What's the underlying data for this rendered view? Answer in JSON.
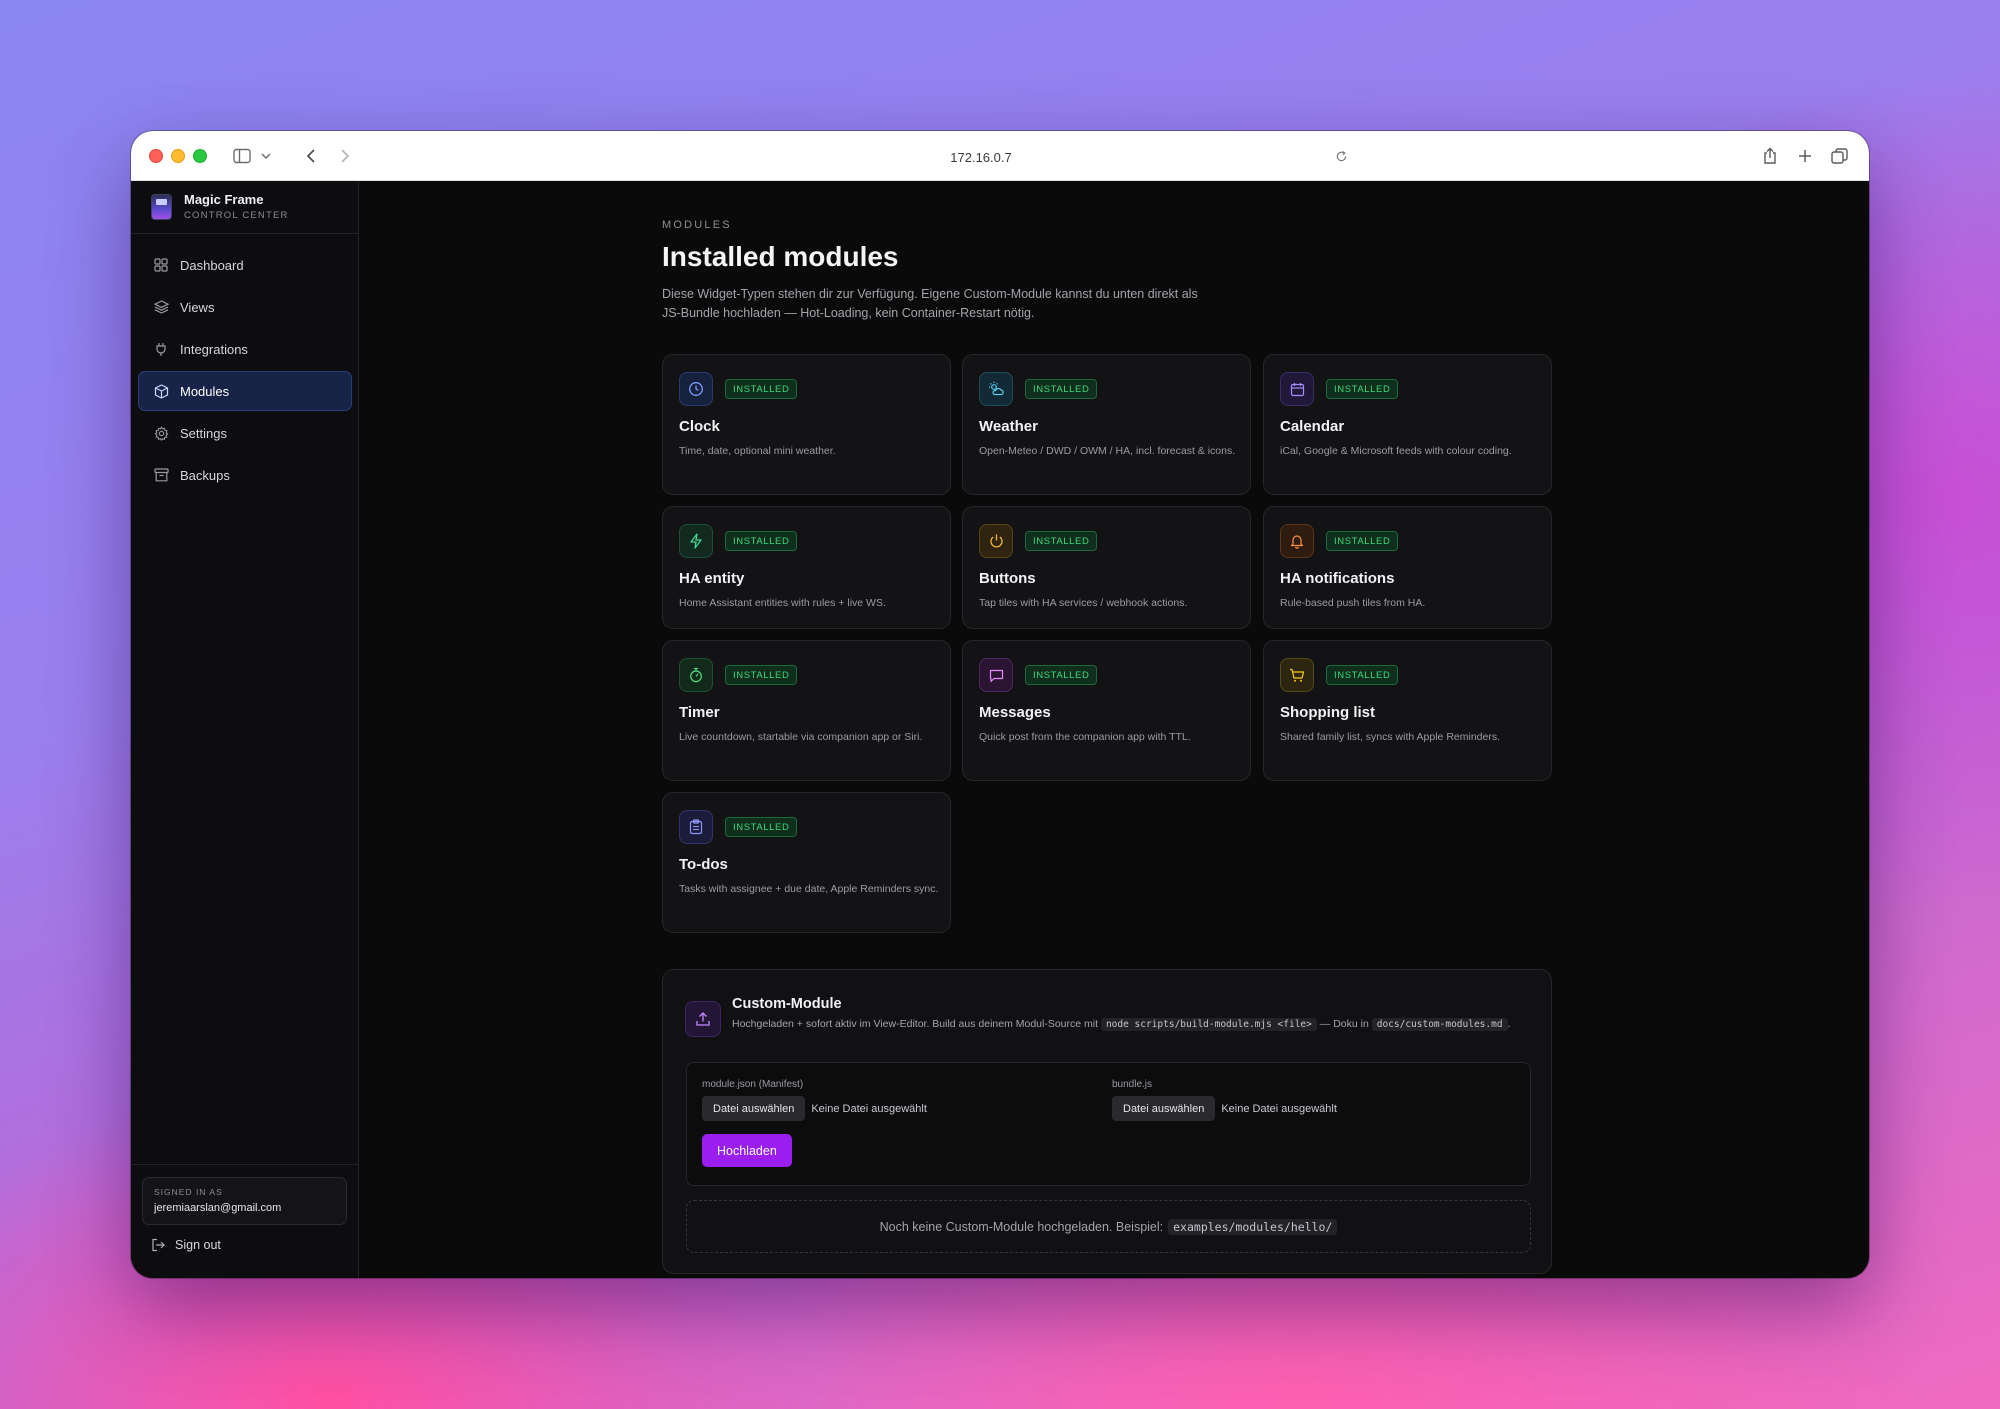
{
  "browser": {
    "url": "172.16.0.7"
  },
  "sidebar": {
    "brand_name": "Magic Frame",
    "brand_sub": "CONTROL CENTER",
    "items": [
      {
        "label": "Dashboard",
        "icon": "grid-icon",
        "active": false
      },
      {
        "label": "Views",
        "icon": "layers-icon",
        "active": false
      },
      {
        "label": "Integrations",
        "icon": "plug-icon",
        "active": false
      },
      {
        "label": "Modules",
        "icon": "box-icon",
        "active": true
      },
      {
        "label": "Settings",
        "icon": "gear-icon",
        "active": false
      },
      {
        "label": "Backups",
        "icon": "archive-icon",
        "active": false
      }
    ],
    "signed_in_label": "SIGNED IN AS",
    "signed_in_email": "jeremiaarslan@gmail.com",
    "sign_out_label": "Sign out"
  },
  "main": {
    "eyebrow": "MODULES",
    "title": "Installed modules",
    "description": "Diese Widget-Typen stehen dir zur Verfügung. Eigene Custom-Module kannst du unten direkt als JS-Bundle hochladen — Hot-Loading, kein Container-Restart nötig.",
    "modules": [
      {
        "title": "Clock",
        "desc": "Time, date, optional mini weather.",
        "badge": "INSTALLED",
        "icon": "clock-icon",
        "color": "#6b8cff"
      },
      {
        "title": "Weather",
        "desc": "Open-Meteo / DWD / OWM / HA, incl. forecast & icons.",
        "badge": "INSTALLED",
        "icon": "sun-cloud-icon",
        "color": "#4fc3e8"
      },
      {
        "title": "Calendar",
        "desc": "iCal, Google & Microsoft feeds with colour coding.",
        "badge": "INSTALLED",
        "icon": "calendar-icon",
        "color": "#a78bfa"
      },
      {
        "title": "HA entity",
        "desc": "Home Assistant entities with rules + live WS.",
        "badge": "INSTALLED",
        "icon": "bolt-icon",
        "color": "#34d399"
      },
      {
        "title": "Buttons",
        "desc": "Tap tiles with HA services / webhook actions.",
        "badge": "INSTALLED",
        "icon": "power-icon",
        "color": "#fbbf24"
      },
      {
        "title": "HA notifications",
        "desc": "Rule-based push tiles from HA.",
        "badge": "INSTALLED",
        "icon": "bell-icon",
        "color": "#fb923c"
      },
      {
        "title": "Timer",
        "desc": "Live countdown, startable via companion app or Siri.",
        "badge": "INSTALLED",
        "icon": "stopwatch-icon",
        "color": "#4ade80"
      },
      {
        "title": "Messages",
        "desc": "Quick post from the companion app with TTL.",
        "badge": "INSTALLED",
        "icon": "message-icon",
        "color": "#e879f9"
      },
      {
        "title": "Shopping list",
        "desc": "Shared family list, syncs with Apple Reminders.",
        "badge": "INSTALLED",
        "icon": "cart-icon",
        "color": "#facc15"
      },
      {
        "title": "To-dos",
        "desc": "Tasks with assignee + due date, Apple Reminders sync.",
        "badge": "INSTALLED",
        "icon": "clipboard-icon",
        "color": "#818cf8"
      }
    ]
  },
  "custom": {
    "title": "Custom-Module",
    "desc_prefix": "Hochgeladen + sofort aktiv im View-Editor. Build aus deinem Modul-Source mit",
    "desc_code1": "node scripts/build-module.mjs <file>",
    "desc_mid": "— Doku in",
    "desc_code2": "docs/custom-modules.md",
    "desc_suffix": ".",
    "manifest_label": "module.json (Manifest)",
    "bundle_label": "bundle.js",
    "choose_file": "Datei auswählen",
    "no_file": "Keine Datei ausgewählt",
    "upload_label": "Hochladen",
    "empty_text": "Noch keine Custom-Module hochgeladen. Beispiel:",
    "empty_code": "examples/modules/hello/"
  }
}
